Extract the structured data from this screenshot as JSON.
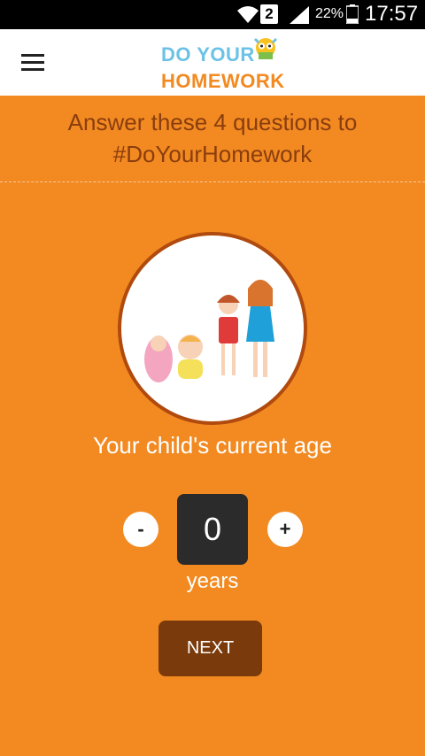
{
  "status_bar": {
    "sim_slot": "2",
    "battery_percent": "22%",
    "time": "17:57",
    "icons": [
      "wifi-icon",
      "sim-icon",
      "signal-icon",
      "battery-icon"
    ]
  },
  "header": {
    "logo_line1": "DO YOUR",
    "logo_line2": "HOMEWORK",
    "menu_icon": "hamburger-menu-icon"
  },
  "intro": {
    "line1": "Answer these 4 questions to",
    "line2": "#DoYourHomework"
  },
  "question": {
    "label": "Your child's current age",
    "illustration": "children-growth-illustration"
  },
  "stepper": {
    "minus_label": "-",
    "value": "0",
    "plus_label": "+",
    "unit": "years"
  },
  "next_button": {
    "label": "NEXT"
  },
  "colors": {
    "background": "#f28a21",
    "heading": "#8a3d0e",
    "logo_blue": "#6cc2e6",
    "logo_orange": "#f28a21",
    "age_box": "#2b2b2b",
    "next_button": "#7a3a0c"
  }
}
